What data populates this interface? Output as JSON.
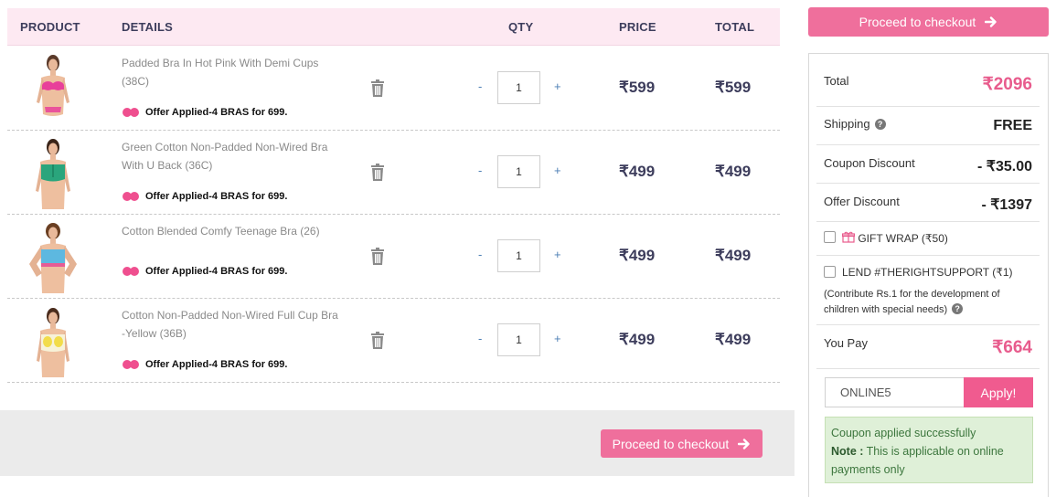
{
  "cart": {
    "headers": {
      "product": "PRODUCT",
      "details": "DETAILS",
      "qty": "QTY",
      "price": "PRICE",
      "total": "TOTAL"
    },
    "items": [
      {
        "name": "Padded Bra In Hot Pink With Demi Cups (38C)",
        "offer": "Offer Applied-4 BRAS for 699.",
        "qty": "1",
        "price": "₹599",
        "total": "₹599",
        "product_color": "#e8409a"
      },
      {
        "name": "Green Cotton Non-Padded Non-Wired Bra With U Back (36C)",
        "offer": "Offer Applied-4 BRAS for 699.",
        "qty": "1",
        "price": "₹499",
        "total": "₹499",
        "product_color": "#2aa57c"
      },
      {
        "name": "Cotton Blended Comfy Teenage Bra (26)",
        "offer": "Offer Applied-4 BRAS for 699.",
        "qty": "1",
        "price": "₹499",
        "total": "₹499",
        "product_color": "#5db8e0"
      },
      {
        "name": "Cotton Non-Padded Non-Wired Full Cup Bra -Yellow (36B)",
        "offer": "Offer Applied-4 BRAS for 699.",
        "qty": "1",
        "price": "₹499",
        "total": "₹499",
        "product_color": "#f2dc4a"
      }
    ],
    "qty_minus": "-",
    "qty_plus": "+",
    "checkout_label": "Proceed to checkout"
  },
  "summary": {
    "checkout_label": "Proceed to checkout",
    "total_label": "Total",
    "total_value": "₹2096",
    "shipping_label": "Shipping",
    "shipping_value": "FREE",
    "coupon_discount_label": "Coupon Discount",
    "coupon_discount_value": "- ₹35.00",
    "offer_discount_label": "Offer Discount",
    "offer_discount_value": "- ₹1397",
    "gift_wrap_label": "GIFT WRAP (₹50)",
    "lend_label": "LEND #THERIGHTSUPPORT (₹1)",
    "lend_note": "(Contribute Rs.1 for the development of children with special needs)",
    "you_pay_label": "You Pay",
    "you_pay_value": "₹664",
    "coupon_code": "ONLINE5",
    "apply_label": "Apply!",
    "success_message": "Coupon applied successfully",
    "note_label": "Note :",
    "note_text": "This is applicable on online payments only"
  },
  "colors": {
    "accent_pink": "#ef6f9c",
    "header_bg": "#fde9f2",
    "success_bg": "#dff0d8"
  }
}
